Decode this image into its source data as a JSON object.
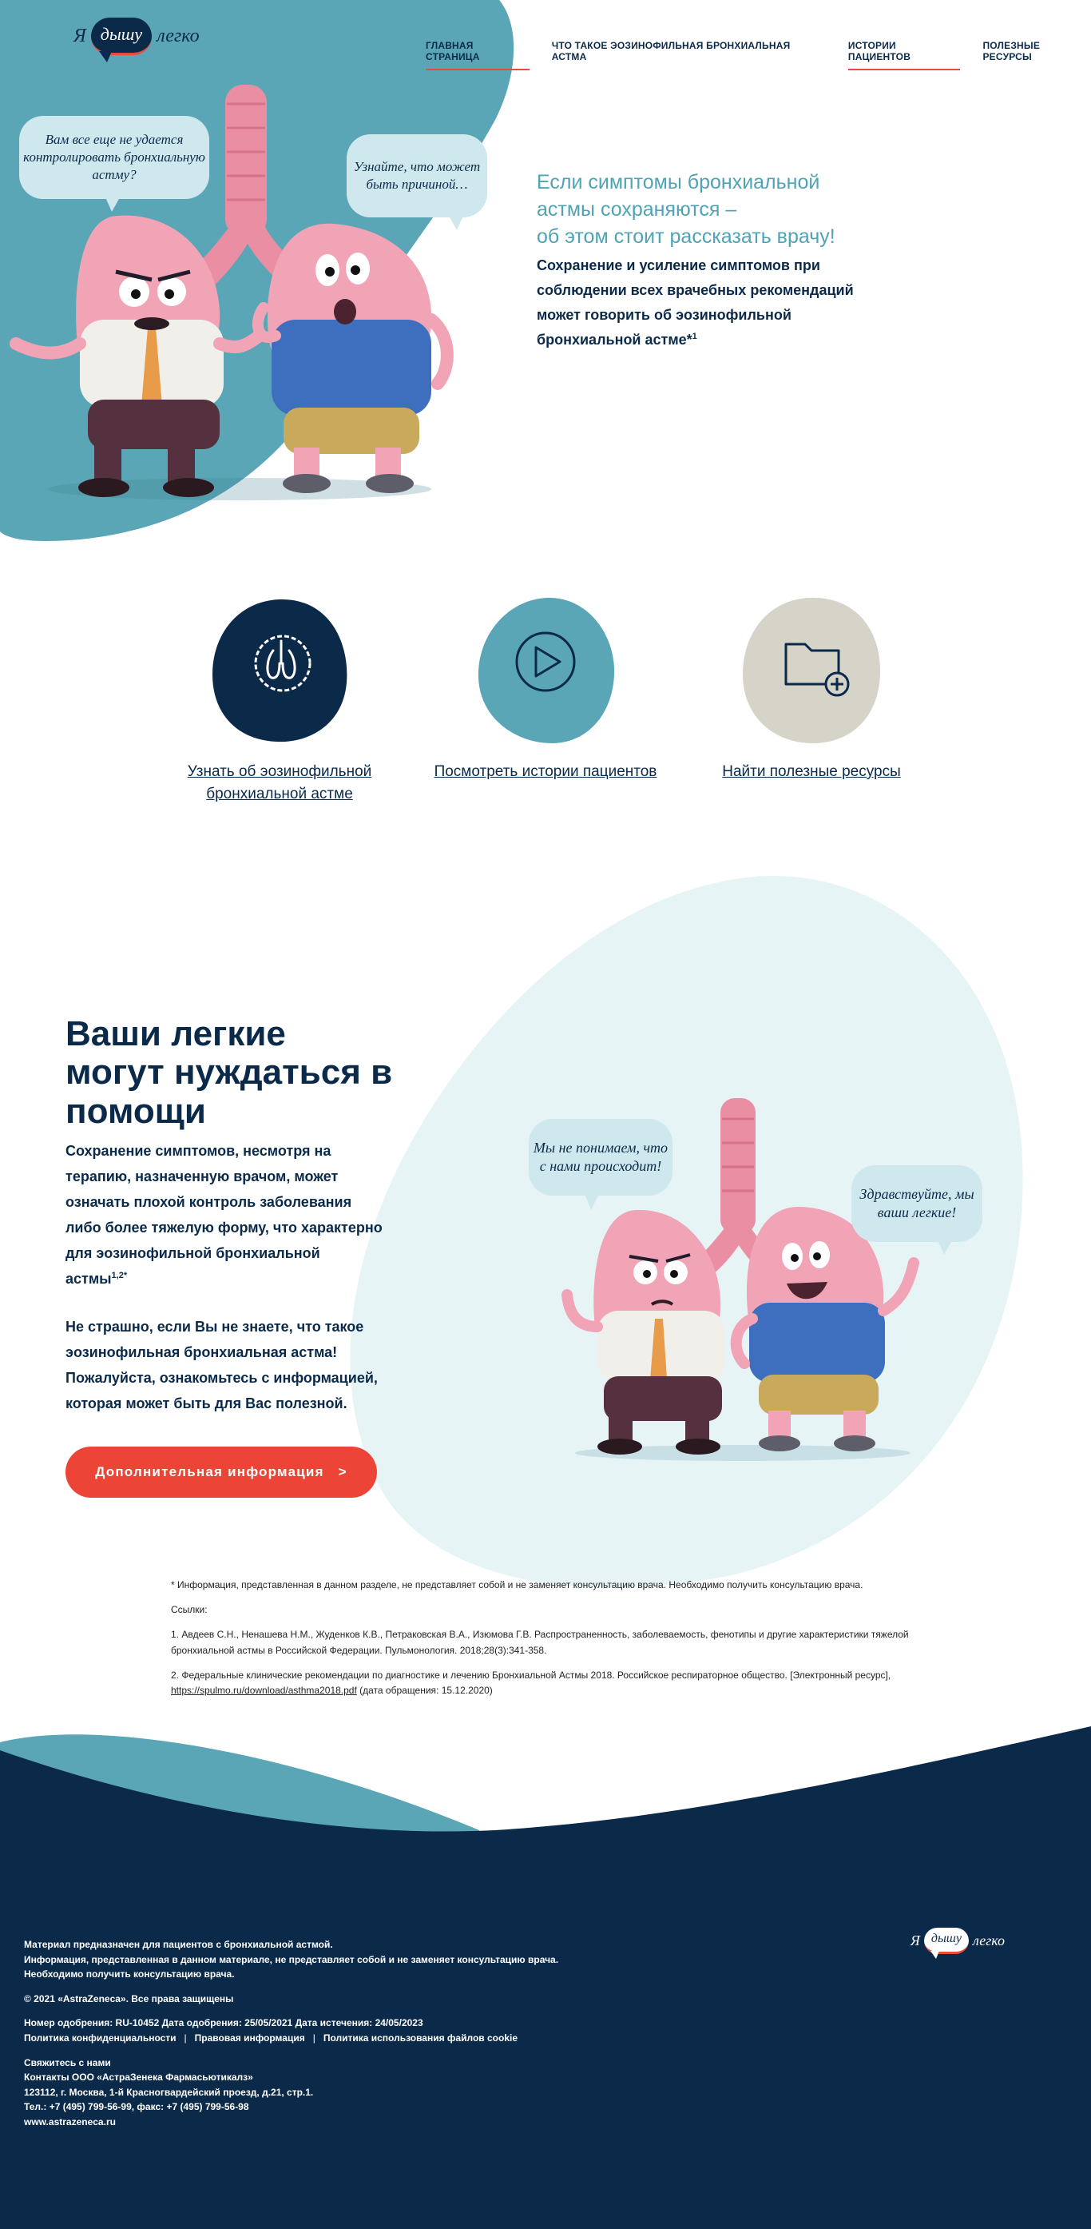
{
  "logo": {
    "left": "Я",
    "bubble": "дышу",
    "right": "легко"
  },
  "nav": {
    "items": [
      "ГЛАВНАЯ СТРАНИЦА",
      "ЧТО ТАКОЕ ЭОЗИНОФИЛЬНАЯ БРОНХИАЛЬНАЯ АСТМА",
      "ИСТОРИИ ПАЦИЕНТОВ",
      "ПОЛЕЗНЫЕ РЕСУРСЫ"
    ]
  },
  "hero": {
    "speech_left": "Вам все еще не удается контролировать бронхиальную астму?",
    "speech_right": "Узнайте, что может быть причиной…",
    "lead_line1": "Если симптомы бронхиальной",
    "lead_line2": "астмы сохраняются –",
    "lead_line3": "об этом стоит рассказать врачу!",
    "body_line1": "Сохранение и усиление симптомов при",
    "body_line2": "соблюдении всех врачебных рекомендаций",
    "body_line3": "может говорить об эозинофильной",
    "body_line4": "бронхиальной астме*",
    "body_sup": "1"
  },
  "features": [
    {
      "label_line1": "Узнать об эозинофильной",
      "label_line2": "бронхиальной астме",
      "icon": "lungs-badge-icon",
      "color": "#0b2a4a"
    },
    {
      "label_line1": "Посмотреть истории пациентов",
      "label_line2": "",
      "icon": "play-icon",
      "color": "#5aa6b6"
    },
    {
      "label_line1": "Найти полезные ресурсы",
      "label_line2": "",
      "icon": "folder-add-icon",
      "color": "#d6d3c8"
    }
  ],
  "help": {
    "title_line1": "Ваши легкие",
    "title_line2": "могут нуждаться в",
    "title_line3": "помощи",
    "p1": "Сохранение симптомов, несмотря на терапию, назначенную врачом, может означать плохой контроль заболевания либо более тяжелую форму, что характерно для эозинофильной бронхиальной астмы",
    "p1_sup": "1,2*",
    "p2": "Не страшно, если Вы не знаете, что такое эозинофильная бронхиальная астма! Пожалуйста, ознакомьтесь с информацией, которая может быть для Вас полезной.",
    "speech_left": "Мы не понимаем, что с нами происходит!",
    "speech_right": "Здравствуйте, мы ваши легкие!",
    "cta_label": "Дополнительная информация",
    "cta_arrow": ">"
  },
  "refs": {
    "note": "* Информация, представленная в данном разделе, не представляет собой и не заменяет консультацию врача. Необходимо получить консультацию врача.",
    "heading": "Ссылки:",
    "ref1": "1. Авдеев С.Н., Ненашева Н.М., Жуденков К.В., Петраковская В.А., Изюмова Г.В. Распространенность, заболеваемость, фенотипы и другие характеристики тяжелой бронхиальной астмы в Российской Федерации. Пульмонология. 2018;28(3):341-358.",
    "ref2_text": "2. Федеральные клинические рекомендации по диагностике и лечению Бронхиальной Астмы 2018. Российское респираторное общество. [Электронный ресурс],",
    "ref2_link": "https://spulmo.ru/download/asthma2018.pdf",
    "ref2_tail": " (дата обращения: 15.12.2020)"
  },
  "footer": {
    "l1": "Материал предназначен для пациентов с бронхиальной астмой.",
    "l2": "Информация, представленная в данном материале, не представляет собой и не заменяет консультацию врача.",
    "l3": "Необходимо получить консультацию врача.",
    "copyright": "© 2021 «AstraZeneca». Все права защищены",
    "approval": "Номер одобрения: RU-10452 Дата одобрения: 25/05/2021 Дата истечения: 24/05/2023",
    "link_privacy": "Политика конфиденциальности",
    "link_legal": "Правовая информация",
    "link_cookie": "Политика использования файлов cookie",
    "sep": "|",
    "contact_heading": "Свяжитесь с нами",
    "contact_company": "Контакты ООО «АстраЗенека Фармасьютикалз»",
    "contact_address": "123112, г. Москва, 1-й Красногвардейский проезд, д.21, стр.1.",
    "contact_phone": "Тел.: +7 (495) 799-56-99, факс: +7 (495) 799-56-98",
    "contact_site": "www.astrazeneca.ru"
  },
  "colors": {
    "navy": "#0b2a4a",
    "teal": "#5aa6b6",
    "light_teal": "#e6f4f6",
    "red": "#ec4538",
    "beige": "#d6d3c8"
  }
}
